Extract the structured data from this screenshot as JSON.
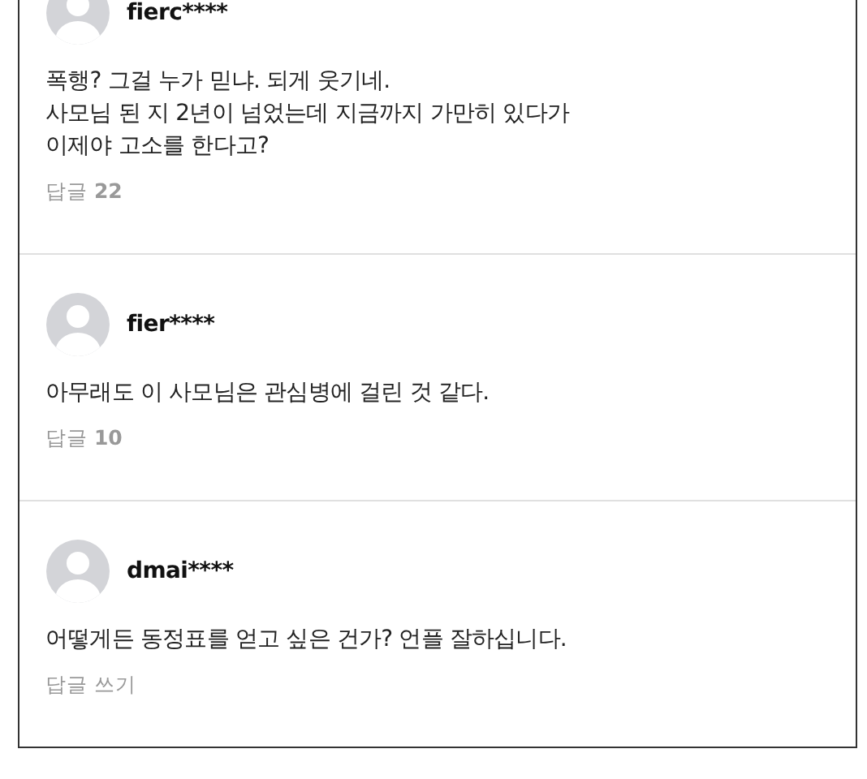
{
  "comments": [
    {
      "author": "fierc****",
      "lines": [
        "폭행? 그걸 누가 믿냐. 되게 웃기네.",
        "사모님 된 지 2년이 넘었는데 지금까지 가만히 있다가",
        "이제야 고소를 한다고?"
      ],
      "reply": "답글 **22**"
    },
    {
      "author": "fier****",
      "lines": [
        "아무래도 이 사모님은 관심병에 걸린 것 같다."
      ],
      "reply": "답글 **10**"
    },
    {
      "author": "dmai****",
      "lines": [
        "어떻게든 동정표를 얻고 싶은 건가? 언플 잘하십니다."
      ],
      "reply": "답글 쓰기"
    }
  ]
}
